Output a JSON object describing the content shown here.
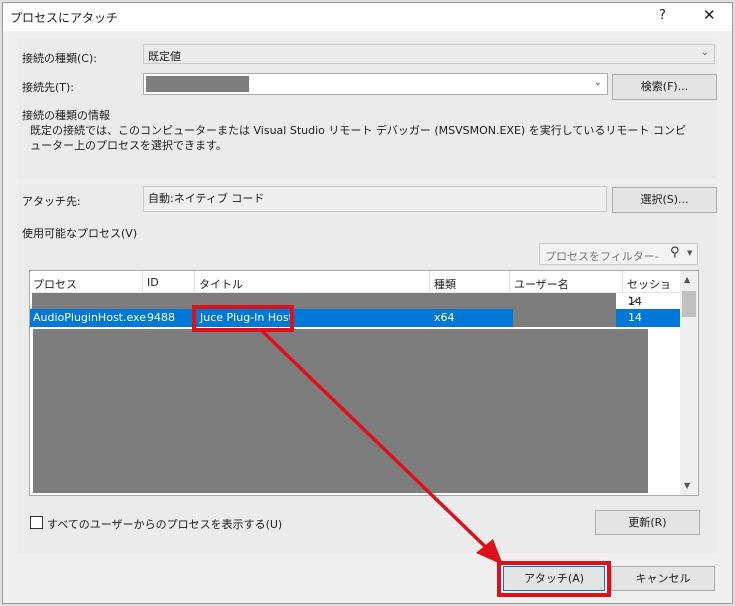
{
  "window": {
    "title": "プロセスにアタッチ",
    "help_glyph": "?",
    "close_glyph": "✕"
  },
  "connection": {
    "type_label": "接続の種類(C):",
    "type_value": "既定値",
    "target_label": "接続先(T):",
    "search_button": "検索(F)...",
    "info_label": "接続の種類の情報",
    "info_text": "既定の接続では、このコンピューターまたは Visual Studio リモート デバッガー (MSVSMON.EXE) を実行しているリモート コンピューター上のプロセスを選択できます。"
  },
  "attach_to": {
    "label": "アタッチ先:",
    "value": "自動:ネイティブ コード",
    "select_button": "選択(S)..."
  },
  "processes": {
    "label": "使用可能なプロセス(V)",
    "filter_placeholder": "プロセスをフィルター-",
    "columns": [
      "プロセス",
      "ID",
      "タイトル",
      "種類",
      "ユーザー名",
      "セッション"
    ],
    "rows": [
      {
        "process": "",
        "id": "",
        "title": "",
        "type": "",
        "user": "",
        "session": "14",
        "selected": false
      },
      {
        "process": "AudioPluginHost.exe",
        "id": "9488",
        "title": "Juce Plug-In Host",
        "type": "x64",
        "user": "",
        "session": "14",
        "selected": true
      }
    ],
    "show_all_users_label": "すべてのユーザーからのプロセスを表示する(U)",
    "show_all_users_checked": false,
    "refresh_button": "更新(R)"
  },
  "footer": {
    "attach_button": "アタッチ(A)",
    "cancel_button": "キャンセル"
  },
  "colors": {
    "selection": "#0078d7",
    "annotation": "#e0101a",
    "redaction": "#7d7d7d"
  },
  "icons": [
    "search-icon",
    "chevron-down-icon",
    "scroll-up-icon",
    "scroll-down-icon",
    "help-icon",
    "close-icon"
  ]
}
